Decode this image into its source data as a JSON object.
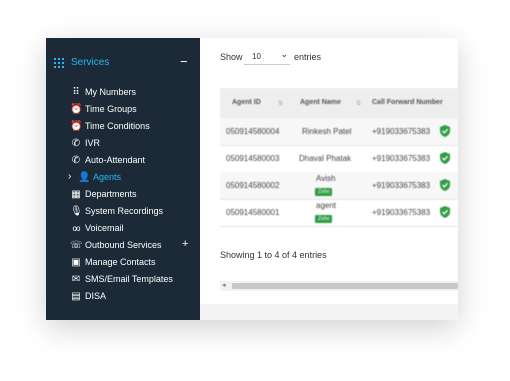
{
  "sidebar": {
    "title": "Services",
    "collapse_symbol": "−",
    "items": [
      {
        "label": "My Numbers",
        "icon": "grid-dots-icon",
        "glyph": "⠿"
      },
      {
        "label": "Time Groups",
        "icon": "alarm-clock-icon",
        "glyph": "⏰"
      },
      {
        "label": "Time Conditions",
        "icon": "alarm-clock-icon",
        "glyph": "⏰"
      },
      {
        "label": "IVR",
        "icon": "phone-icon",
        "glyph": "✆"
      },
      {
        "label": "Auto-Attendant",
        "icon": "phone-forward-icon",
        "glyph": "✆"
      },
      {
        "label": "Agents",
        "icon": "person-icon",
        "glyph": "👤",
        "active": true
      },
      {
        "label": "Departments",
        "icon": "building-icon",
        "glyph": "▦"
      },
      {
        "label": "System Recordings",
        "icon": "microphone-icon",
        "glyph": "🎙"
      },
      {
        "label": "Voicemail",
        "icon": "voicemail-icon",
        "glyph": "oo"
      },
      {
        "label": "Outbound Services",
        "icon": "outbound-call-icon",
        "glyph": "☏"
      },
      {
        "label": "Manage Contacts",
        "icon": "contacts-icon",
        "glyph": "▣"
      },
      {
        "label": "SMS/Email Templates",
        "icon": "message-icon",
        "glyph": "✉"
      },
      {
        "label": "DISA",
        "icon": "keypad-icon",
        "glyph": "▤"
      }
    ],
    "chevron": "›",
    "plus": "+"
  },
  "main": {
    "show_label": "Show",
    "page_size": "10",
    "entries_label": "entries",
    "table": {
      "columns": [
        "Agent ID",
        "Agent Name",
        "Call Forward Number"
      ],
      "rows": [
        {
          "id": "050914580004",
          "name": "Rinkesh Patel",
          "badge": "",
          "forward": "+919033675383"
        },
        {
          "id": "050914580003",
          "name": "Dhaval Phatak",
          "badge": "",
          "forward": "+919033675383"
        },
        {
          "id": "050914580002",
          "name": "Avish",
          "badge": "Zoho",
          "forward": "+919033675383"
        },
        {
          "id": "050914580001",
          "name": "agent",
          "badge": "Zoho",
          "forward": "+919033675383"
        }
      ]
    },
    "info": "Showing 1 to 4 of 4 entries"
  },
  "colors": {
    "sidebar_bg": "#1b2a36",
    "accent": "#29b6f6",
    "verified": "#2e9e44"
  }
}
